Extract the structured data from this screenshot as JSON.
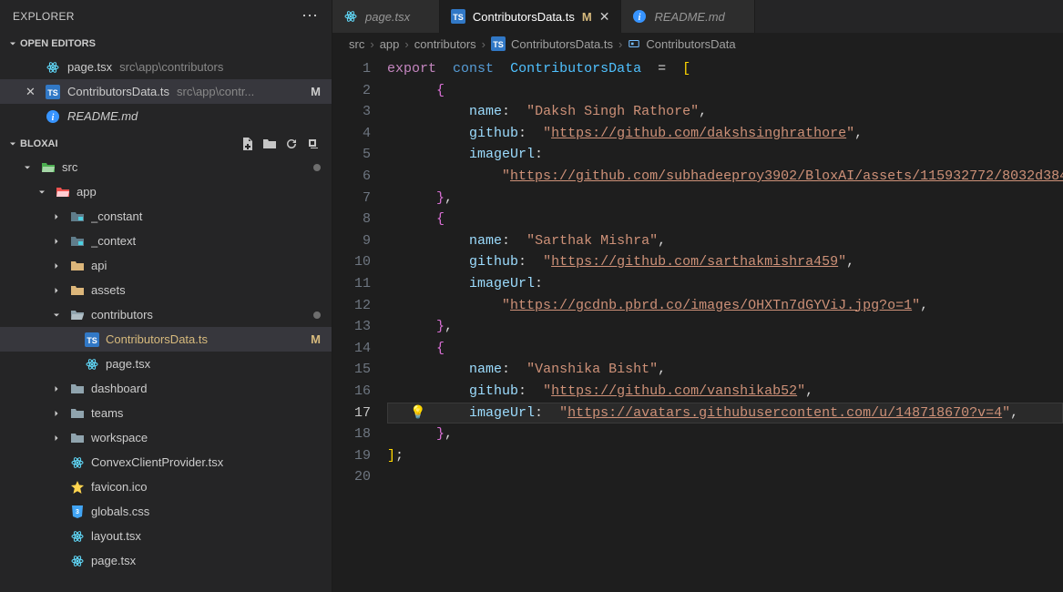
{
  "sidebar": {
    "title": "EXPLORER",
    "sections": {
      "openEditors": {
        "title": "OPEN EDITORS",
        "items": [
          {
            "icon": "react",
            "name": "page.tsx",
            "path": "src\\app\\contributors",
            "active": false,
            "badge": ""
          },
          {
            "icon": "ts",
            "name": "ContributorsData.ts",
            "path": "src\\app\\contr...",
            "active": true,
            "badge": "M"
          },
          {
            "icon": "info",
            "name": "README.md",
            "path": "",
            "active": false,
            "badge": ""
          }
        ]
      },
      "project": {
        "title": "BLOXAI",
        "tree": [
          {
            "d": 1,
            "chev": "down",
            "icon": "folder-src",
            "label": "src",
            "dot": "#6e6e6e"
          },
          {
            "d": 2,
            "chev": "down",
            "icon": "folder-app",
            "label": "app"
          },
          {
            "d": 3,
            "chev": "right",
            "icon": "folder-gray",
            "label": "_constant"
          },
          {
            "d": 3,
            "chev": "right",
            "icon": "folder-gray",
            "label": "_context"
          },
          {
            "d": 3,
            "chev": "right",
            "icon": "folder-yellow",
            "label": "api"
          },
          {
            "d": 3,
            "chev": "right",
            "icon": "folder-yellow",
            "label": "assets"
          },
          {
            "d": 3,
            "chev": "down",
            "icon": "folder-open",
            "label": "contributors",
            "dot": "#6e6e6e"
          },
          {
            "d": 4,
            "chev": "",
            "icon": "ts",
            "label": "ContributorsData.ts",
            "badge": "M",
            "selected": true,
            "mod": true
          },
          {
            "d": 4,
            "chev": "",
            "icon": "react",
            "label": "page.tsx"
          },
          {
            "d": 3,
            "chev": "right",
            "icon": "folder",
            "label": "dashboard"
          },
          {
            "d": 3,
            "chev": "right",
            "icon": "folder",
            "label": "teams"
          },
          {
            "d": 3,
            "chev": "right",
            "icon": "folder",
            "label": "workspace"
          },
          {
            "d": 3,
            "chev": "",
            "icon": "react",
            "label": "ConvexClientProvider.tsx"
          },
          {
            "d": 3,
            "chev": "",
            "icon": "star",
            "label": "favicon.ico"
          },
          {
            "d": 3,
            "chev": "",
            "icon": "css",
            "label": "globals.css"
          },
          {
            "d": 3,
            "chev": "",
            "icon": "react",
            "label": "layout.tsx"
          },
          {
            "d": 3,
            "chev": "",
            "icon": "react",
            "label": "page.tsx"
          }
        ]
      }
    }
  },
  "tabs": [
    {
      "icon": "react",
      "label": "page.tsx",
      "active": false,
      "badge": ""
    },
    {
      "icon": "ts",
      "label": "ContributorsData.ts",
      "active": true,
      "badge": "M"
    },
    {
      "icon": "info",
      "label": "README.md",
      "active": false,
      "badge": ""
    }
  ],
  "breadcrumb": {
    "parts": [
      "src",
      "app",
      "contributors",
      "ContributorsData.ts",
      "ContributorsData"
    ]
  },
  "code": {
    "activeLine": 17,
    "lines": [
      {
        "n": 1,
        "t": [
          [
            "kw",
            "export"
          ],
          [
            "sp",
            " "
          ],
          [
            "skw",
            "const"
          ],
          [
            "sp",
            " "
          ],
          [
            "var",
            "ContributorsData"
          ],
          [
            "sp",
            " "
          ],
          [
            "pun",
            "="
          ],
          [
            "sp",
            " "
          ],
          [
            "brk1",
            "["
          ]
        ]
      },
      {
        "n": 2,
        "t": [
          [
            "sp",
            "   "
          ],
          [
            "brk2",
            "{"
          ]
        ]
      },
      {
        "n": 3,
        "t": [
          [
            "sp",
            "     "
          ],
          [
            "prop",
            "name"
          ],
          [
            "pun",
            ":"
          ],
          [
            "sp",
            " "
          ],
          [
            "str",
            "\"Daksh Singh Rathore\""
          ],
          [
            "pun",
            ","
          ]
        ]
      },
      {
        "n": 4,
        "t": [
          [
            "sp",
            "     "
          ],
          [
            "prop",
            "github"
          ],
          [
            "pun",
            ":"
          ],
          [
            "sp",
            " "
          ],
          [
            "str",
            "\""
          ],
          [
            "lnk",
            "https://github.com/dakshsinghrathore"
          ],
          [
            "str",
            "\""
          ],
          [
            "pun",
            ","
          ]
        ]
      },
      {
        "n": 5,
        "t": [
          [
            "sp",
            "     "
          ],
          [
            "prop",
            "imageUrl"
          ],
          [
            "pun",
            ":"
          ]
        ]
      },
      {
        "n": 6,
        "t": [
          [
            "sp",
            "       "
          ],
          [
            "str",
            "\""
          ],
          [
            "lnk",
            "https://github.com/subhadeeproy3902/BloxAI/assets/115932772/8032d384"
          ]
        ]
      },
      {
        "n": 7,
        "t": [
          [
            "sp",
            "   "
          ],
          [
            "brk2",
            "}"
          ],
          [
            "pun",
            ","
          ]
        ]
      },
      {
        "n": 8,
        "t": [
          [
            "sp",
            "   "
          ],
          [
            "brk2",
            "{"
          ]
        ]
      },
      {
        "n": 9,
        "t": [
          [
            "sp",
            "     "
          ],
          [
            "prop",
            "name"
          ],
          [
            "pun",
            ":"
          ],
          [
            "sp",
            " "
          ],
          [
            "str",
            "\"Sarthak Mishra\""
          ],
          [
            "pun",
            ","
          ]
        ]
      },
      {
        "n": 10,
        "t": [
          [
            "sp",
            "     "
          ],
          [
            "prop",
            "github"
          ],
          [
            "pun",
            ":"
          ],
          [
            "sp",
            " "
          ],
          [
            "str",
            "\""
          ],
          [
            "lnk",
            "https://github.com/sarthakmishra459"
          ],
          [
            "str",
            "\""
          ],
          [
            "pun",
            ","
          ]
        ]
      },
      {
        "n": 11,
        "t": [
          [
            "sp",
            "     "
          ],
          [
            "prop",
            "imageUrl"
          ],
          [
            "pun",
            ":"
          ]
        ]
      },
      {
        "n": 12,
        "t": [
          [
            "sp",
            "       "
          ],
          [
            "str",
            "\""
          ],
          [
            "lnk",
            "https://gcdnb.pbrd.co/images/OHXTn7dGYViJ.jpg?o=1"
          ],
          [
            "str",
            "\""
          ],
          [
            "pun",
            ","
          ]
        ]
      },
      {
        "n": 13,
        "t": [
          [
            "sp",
            "   "
          ],
          [
            "brk2",
            "}"
          ],
          [
            "pun",
            ","
          ]
        ]
      },
      {
        "n": 14,
        "t": [
          [
            "sp",
            "   "
          ],
          [
            "brk2",
            "{"
          ]
        ]
      },
      {
        "n": 15,
        "t": [
          [
            "sp",
            "     "
          ],
          [
            "prop",
            "name"
          ],
          [
            "pun",
            ":"
          ],
          [
            "sp",
            " "
          ],
          [
            "str",
            "\"Vanshika Bisht\""
          ],
          [
            "pun",
            ","
          ]
        ]
      },
      {
        "n": 16,
        "t": [
          [
            "sp",
            "     "
          ],
          [
            "prop",
            "github"
          ],
          [
            "pun",
            ":"
          ],
          [
            "sp",
            " "
          ],
          [
            "str",
            "\""
          ],
          [
            "lnk",
            "https://github.com/vanshikab52"
          ],
          [
            "str",
            "\""
          ],
          [
            "pun",
            ","
          ]
        ]
      },
      {
        "n": 17,
        "t": [
          [
            "sp",
            "     "
          ],
          [
            "prop",
            "imageUrl"
          ],
          [
            "pun",
            ":"
          ],
          [
            "sp",
            " "
          ],
          [
            "str",
            "\""
          ],
          [
            "lnk",
            "https://avatars.githubusercontent.com/u/148718670?v=4"
          ],
          [
            "str",
            "\""
          ],
          [
            "pun",
            ","
          ]
        ]
      },
      {
        "n": 18,
        "t": [
          [
            "sp",
            "   "
          ],
          [
            "brk2",
            "}"
          ],
          [
            "pun",
            ","
          ]
        ]
      },
      {
        "n": 19,
        "t": [
          [
            "brk1",
            "]"
          ],
          [
            "pun",
            ";"
          ]
        ]
      },
      {
        "n": 20,
        "t": []
      }
    ]
  }
}
